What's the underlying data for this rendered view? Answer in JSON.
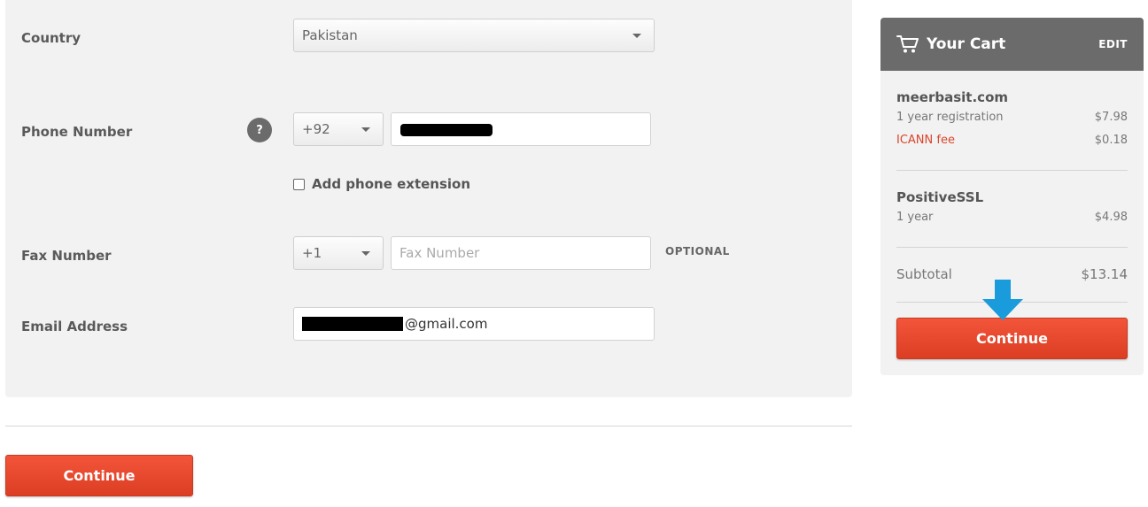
{
  "form": {
    "country_label": "Country",
    "country_value": "Pakistan",
    "phone_label": "Phone Number",
    "phone_code": "+92",
    "help_glyph": "?",
    "phone_extension_label": "Add phone extension",
    "fax_label": "Fax Number",
    "fax_code": "+1",
    "fax_placeholder": "Fax Number",
    "fax_optional": "OPTIONAL",
    "email_label": "Email Address",
    "email_value_suffix": "@gmail.com",
    "continue_label": "Continue"
  },
  "cart": {
    "title": "Your Cart",
    "edit_label": "EDIT",
    "items": [
      {
        "name": "meerbasit.com",
        "lines": [
          {
            "label": "1 year registration",
            "price": "$7.98"
          },
          {
            "label": "ICANN fee",
            "price": "$0.18"
          }
        ]
      },
      {
        "name": "PositiveSSL",
        "lines": [
          {
            "label": "1 year",
            "price": "$4.98"
          }
        ]
      }
    ],
    "subtotal_label": "Subtotal",
    "subtotal_value": "$13.14",
    "continue_label": "Continue"
  },
  "colors": {
    "accent": "#e8482d",
    "cart_header": "#6b6b6b",
    "arrow": "#1a9bdc",
    "fee_text": "#d9462b"
  },
  "icons": {
    "cart": "shopping-cart-icon",
    "help": "question-icon",
    "caret": "caret-down-icon",
    "arrow": "down-arrow-icon"
  }
}
